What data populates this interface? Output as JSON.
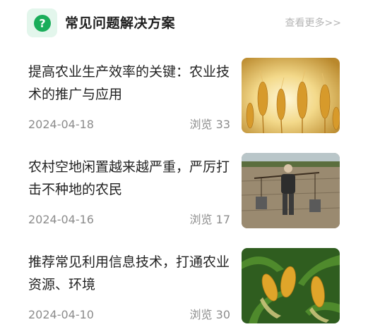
{
  "header": {
    "title": "常见问题解决方案",
    "more_label": "查看更多>>",
    "icon": "question-mark-icon",
    "icon_symbol": "?",
    "accent_color": "#1aad5a"
  },
  "articles": [
    {
      "title": "提高农业生产效率的关键：农业技术的推广与应用",
      "date": "2024-04-18",
      "views": "浏览 33",
      "image": "wheat-field-image"
    },
    {
      "title": "农村空地闲置越来越严重，严厉打击不种地的农民",
      "date": "2024-04-16",
      "views": "浏览 17",
      "image": "farmer-carrying-buckets-image"
    },
    {
      "title": "推荐常见利用信息技术，打通农业资源、环境",
      "date": "2024-04-10",
      "views": "浏览 30",
      "image": "corn-field-image"
    }
  ]
}
